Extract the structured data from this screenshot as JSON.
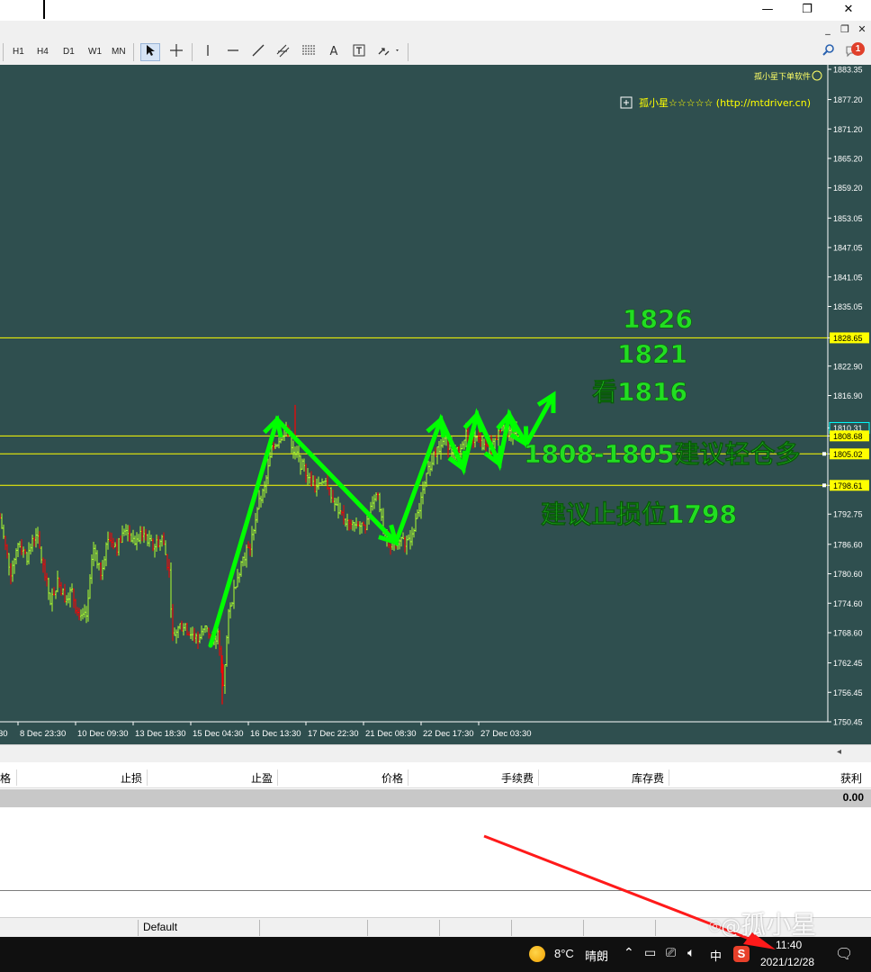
{
  "window": {
    "minimize_glyph": "—",
    "restore_glyph": "❐",
    "close_glyph": "✕"
  },
  "mdi_controls": {
    "min": "_",
    "restore": "❐",
    "close": "✕"
  },
  "toolbar": {
    "timeframes": [
      "H1",
      "H4",
      "D1",
      "W1",
      "MN"
    ],
    "text_tool": "A",
    "label_tool": "T",
    "notification_count": "1"
  },
  "chart_data": {
    "type": "bar",
    "timeframe_note": "price chart (OHLC bars) with annotation arrows",
    "x_tick_labels": [
      "30",
      "8 Dec 23:30",
      "10 Dec 09:30",
      "13 Dec 18:30",
      "15 Dec 04:30",
      "16 Dec 13:30",
      "17 Dec 22:30",
      "21 Dec 08:30",
      "22 Dec 17:30",
      "27 Dec 03:30"
    ],
    "y_tick_labels": [
      "1883.35",
      "1877.20",
      "1871.20",
      "1865.20",
      "1859.20",
      "1853.05",
      "1847.05",
      "1841.05",
      "1835.05",
      "1828.65",
      "1822.90",
      "1816.90",
      "1810.31",
      "1808.68",
      "1805.02",
      "1798.61",
      "1792.75",
      "1786.60",
      "1780.60",
      "1774.60",
      "1768.60",
      "1762.45",
      "1756.45",
      "1750.45"
    ],
    "ylim": [
      1750.45,
      1883.35
    ],
    "horizontal_lines": [
      1828.65,
      1808.68,
      1805.02,
      1798.61
    ],
    "highlighted_labels": [
      "1828.65",
      "1808.68",
      "1805.02",
      "1798.61",
      "1810.31"
    ],
    "price_path": [
      [
        0,
        1792
      ],
      [
        6,
        1786
      ],
      [
        12,
        1781
      ],
      [
        20,
        1787
      ],
      [
        30,
        1784
      ],
      [
        40,
        1789
      ],
      [
        48,
        1782
      ],
      [
        56,
        1775
      ],
      [
        64,
        1779
      ],
      [
        72,
        1776
      ],
      [
        80,
        1777
      ],
      [
        88,
        1771
      ],
      [
        96,
        1772
      ],
      [
        104,
        1786
      ],
      [
        112,
        1781
      ],
      [
        120,
        1788
      ],
      [
        130,
        1786
      ],
      [
        140,
        1790
      ],
      [
        150,
        1787
      ],
      [
        160,
        1789
      ],
      [
        170,
        1786
      ],
      [
        180,
        1788
      ],
      [
        188,
        1781
      ],
      [
        192,
        1768
      ],
      [
        200,
        1770
      ],
      [
        210,
        1769
      ],
      [
        220,
        1767
      ],
      [
        230,
        1770
      ],
      [
        236,
        1766
      ],
      [
        242,
        1768
      ],
      [
        248,
        1758
      ],
      [
        254,
        1772
      ],
      [
        262,
        1779
      ],
      [
        270,
        1784
      ],
      [
        278,
        1786
      ],
      [
        286,
        1794
      ],
      [
        294,
        1798
      ],
      [
        302,
        1806
      ],
      [
        310,
        1808
      ],
      [
        318,
        1811
      ],
      [
        326,
        1806
      ],
      [
        334,
        1803
      ],
      [
        342,
        1801
      ],
      [
        350,
        1798
      ],
      [
        358,
        1800
      ],
      [
        366,
        1797
      ],
      [
        374,
        1794
      ],
      [
        382,
        1792
      ],
      [
        390,
        1790
      ],
      [
        398,
        1791
      ],
      [
        406,
        1789
      ],
      [
        414,
        1796
      ],
      [
        420,
        1797
      ],
      [
        426,
        1790
      ],
      [
        432,
        1786
      ],
      [
        438,
        1788
      ],
      [
        446,
        1787
      ],
      [
        454,
        1787
      ],
      [
        462,
        1791
      ],
      [
        470,
        1797
      ],
      [
        478,
        1803
      ],
      [
        486,
        1806
      ],
      [
        494,
        1808
      ],
      [
        502,
        1806
      ],
      [
        510,
        1805
      ],
      [
        518,
        1809
      ],
      [
        526,
        1808
      ],
      [
        534,
        1807
      ],
      [
        542,
        1806
      ],
      [
        550,
        1808
      ],
      [
        558,
        1810
      ],
      [
        566,
        1809
      ],
      [
        574,
        1810
      ]
    ],
    "trend_arrow_points": [
      [
        234,
        1766
      ],
      [
        308,
        1812
      ],
      [
        440,
        1787
      ],
      [
        490,
        1812
      ],
      [
        515,
        1802
      ],
      [
        530,
        1813
      ],
      [
        555,
        1803
      ],
      [
        566,
        1813
      ],
      [
        585,
        1807
      ],
      [
        615,
        1817
      ]
    ],
    "annotations": {
      "target1": "1826",
      "target2": "1821",
      "target3": "看1816",
      "entry": "1808-1805建议轻仓多",
      "stop": "建议止损位1798"
    },
    "ea_label": "孤小星☆☆☆☆☆ (http://mtdriver.cn)",
    "ea_name": "孤小星下单软件",
    "colors": {
      "background": "#2f4f4f",
      "grid_line": "#ffff00",
      "up_bar": "#adff2f",
      "down_bar": "#ff0000",
      "arrow": "#00ff00",
      "axis_text": "#ffffff",
      "highlight_label_bg": "#ffff00"
    }
  },
  "terminal": {
    "headers": [
      "格",
      "止损",
      "止盈",
      "价格",
      "手续费",
      "库存费",
      "获利"
    ],
    "total_profit": "0.00"
  },
  "statusbar": {
    "profile": "Default"
  },
  "taskbar": {
    "temperature": "8°C",
    "weather": "晴朗",
    "ime": "中",
    "time": "11:40",
    "date": "2021/12/28"
  },
  "watermark": "孤小星"
}
